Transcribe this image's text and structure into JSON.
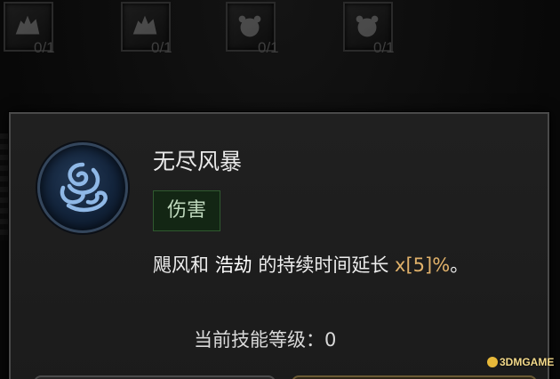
{
  "slots": [
    {
      "icon": "wolf-icon",
      "count": "0/1"
    },
    {
      "icon": "wolf-icon",
      "count": "0/1"
    },
    {
      "icon": "bear-icon",
      "count": "0/1"
    },
    {
      "icon": "bear-icon",
      "count": "0/1"
    }
  ],
  "tooltip": {
    "icon": "whirlwind-icon",
    "title": "无尽风暴",
    "tag": "伤害",
    "desc": {
      "part1": "飓风和 ",
      "part2": "浩劫",
      "part3": " 的持续时间延长 ",
      "value": "x[5]%",
      "end": "。"
    },
    "level_text": "当前技能等级：0"
  },
  "watermark": "3DMGAME",
  "colors": {
    "tag_bg": "#132614",
    "value_highlight": "#e0b16a",
    "icon_blue": "#243a57"
  }
}
